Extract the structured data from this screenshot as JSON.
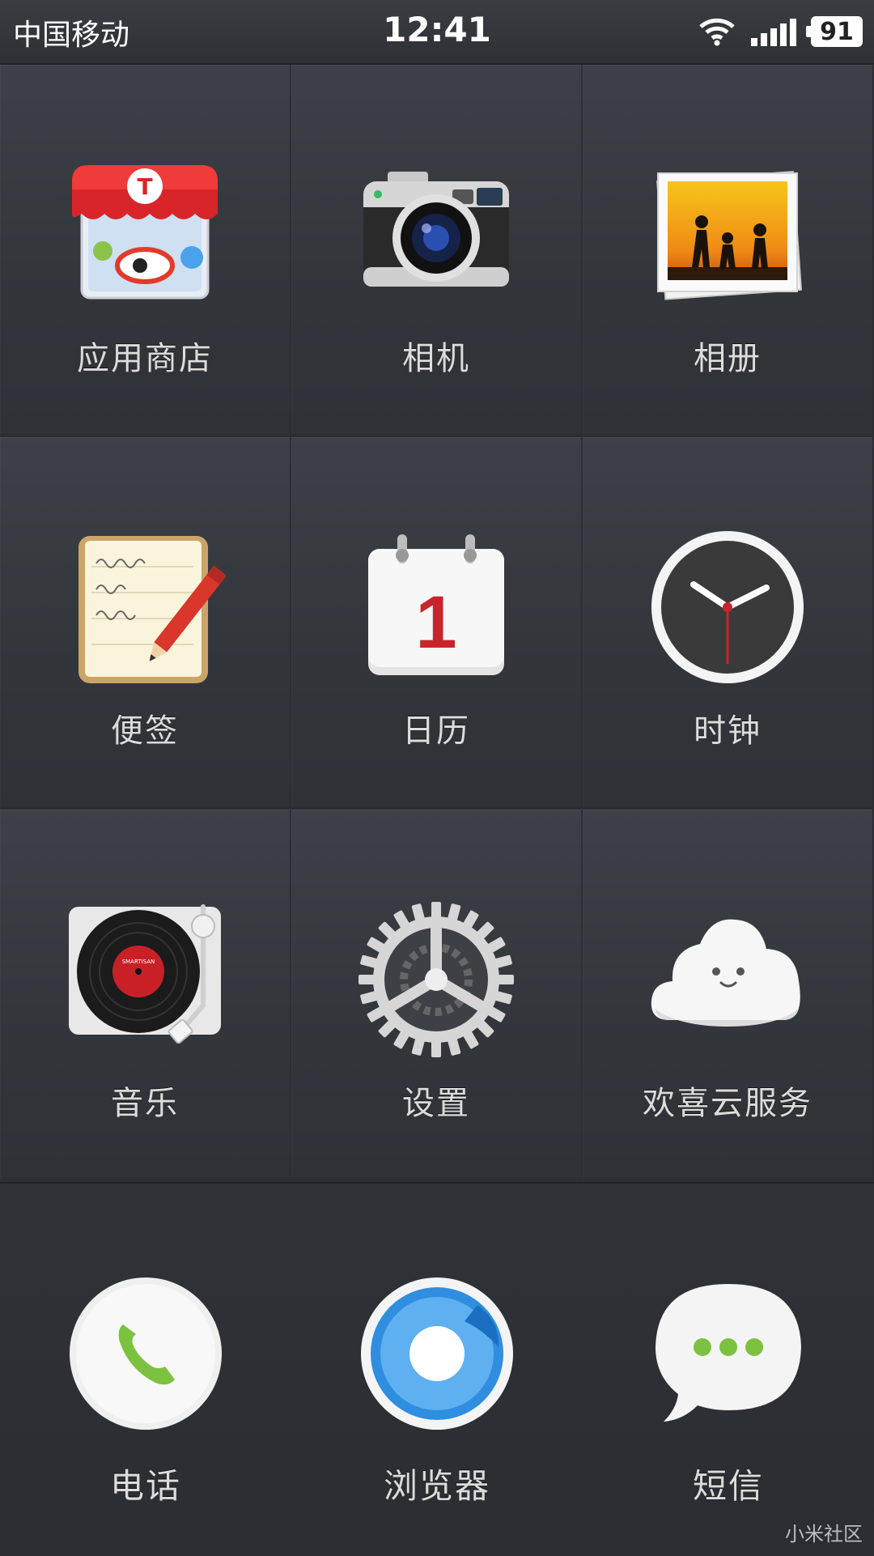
{
  "status_bar": {
    "carrier": "中国移动",
    "time": "12:41",
    "battery": "91",
    "icons": [
      "wifi-icon",
      "signal-icon",
      "battery-icon"
    ]
  },
  "apps": [
    {
      "label": "应用商店",
      "icon": "app-store-icon"
    },
    {
      "label": "相机",
      "icon": "camera-icon"
    },
    {
      "label": "相册",
      "icon": "gallery-icon"
    },
    {
      "label": "便签",
      "icon": "notes-icon"
    },
    {
      "label": "日历",
      "icon": "calendar-icon",
      "calendar_day": "1"
    },
    {
      "label": "时钟",
      "icon": "clock-icon"
    },
    {
      "label": "音乐",
      "icon": "music-icon",
      "record_label_text": "SMARTISAN"
    },
    {
      "label": "设置",
      "icon": "settings-icon"
    },
    {
      "label": "欢喜云服务",
      "icon": "cloud-service-icon"
    }
  ],
  "dock": [
    {
      "label": "电话",
      "icon": "phone-icon"
    },
    {
      "label": "浏览器",
      "icon": "browser-icon"
    },
    {
      "label": "短信",
      "icon": "messages-icon"
    }
  ],
  "watermark": "小米社区",
  "colors": {
    "background": "#2b2e33",
    "label": "#dcdcdc",
    "store_red": "#d8252a",
    "phone_green": "#7cc240",
    "browser_blue": "#2f8ee0"
  }
}
